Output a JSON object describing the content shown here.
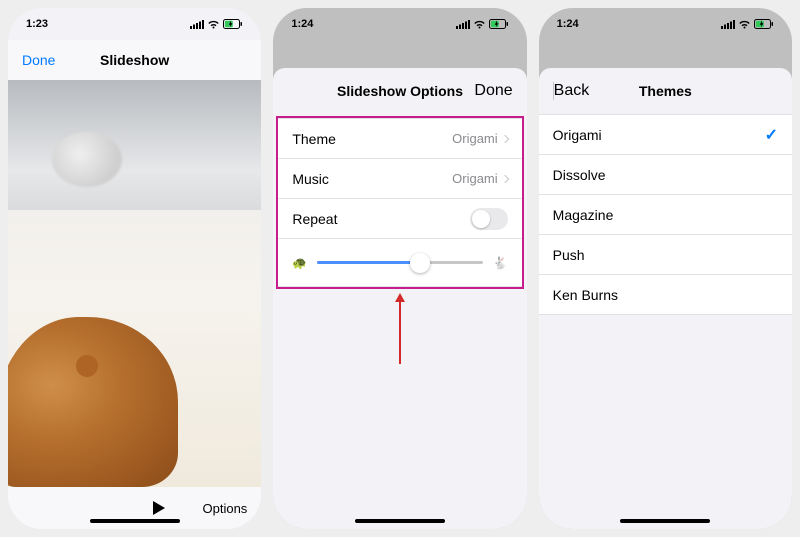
{
  "phone1": {
    "time": "1:23",
    "done": "Done",
    "title": "Slideshow",
    "options": "Options"
  },
  "phone2": {
    "time": "1:24",
    "title": "Slideshow Options",
    "done": "Done",
    "rows": {
      "theme_label": "Theme",
      "theme_value": "Origami",
      "music_label": "Music",
      "music_value": "Origami",
      "repeat_label": "Repeat"
    },
    "slider": {
      "percent": 62,
      "slow_icon": "turtle-icon",
      "fast_icon": "rabbit-icon"
    }
  },
  "phone3": {
    "time": "1:24",
    "back": "Back",
    "title": "Themes",
    "items": [
      {
        "label": "Origami",
        "selected": true
      },
      {
        "label": "Dissolve",
        "selected": false
      },
      {
        "label": "Magazine",
        "selected": false
      },
      {
        "label": "Push",
        "selected": false
      },
      {
        "label": "Ken Burns",
        "selected": false
      }
    ]
  }
}
